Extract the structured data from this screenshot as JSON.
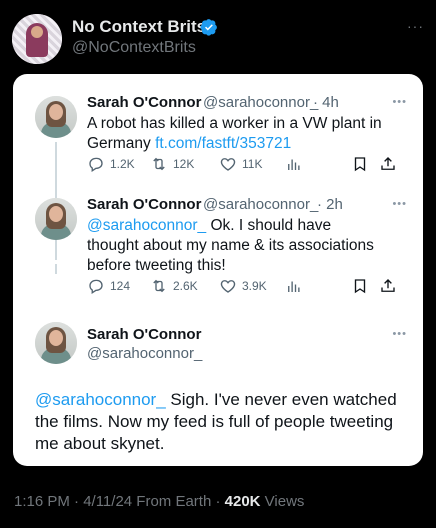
{
  "main": {
    "display_name": "No Context Brits",
    "handle": "@NoContextBrits",
    "more": "···"
  },
  "tweets": [
    {
      "name": "Sarah O'Connor",
      "handle": "@sarahoconnor_",
      "time": "· 4h",
      "text": "A robot has killed a worker in a VW plant in Germany ",
      "link": "ft.com/fastft/353721",
      "replies": "1.2K",
      "retweets": "12K",
      "likes": "11K"
    },
    {
      "name": "Sarah O'Connor",
      "handle": "@sarahoconnor_",
      "time": "· 2h",
      "mention": "@sarahoconnor_",
      "text": " Ok. I should have thought about my name & its associations before tweeting this!",
      "replies": "124",
      "retweets": "2.6K",
      "likes": "3.9K"
    },
    {
      "name": "Sarah O'Connor",
      "handle": "@sarahoconnor_",
      "mention": "@sarahoconnor_",
      "text": " Sigh. I've never even watched the films. Now my feed is full of people tweeting me about skynet."
    }
  ],
  "footer": {
    "time": "1:16 PM · 4/11/24 From Earth · ",
    "views_count": "420K",
    "views_label": " Views"
  },
  "colors": {
    "background": "#000000",
    "card": "#ffffff",
    "link": "#1d9bf0",
    "verified": "#1d9bf0"
  }
}
